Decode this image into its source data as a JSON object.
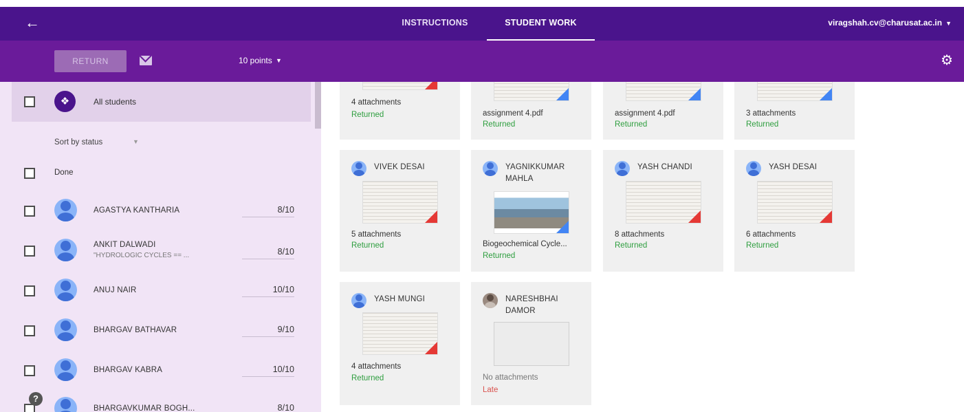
{
  "header": {
    "tabs": [
      {
        "label": "INSTRUCTIONS"
      },
      {
        "label": "STUDENT WORK"
      }
    ],
    "account": "viragshah.cv@charusat.ac.in"
  },
  "toolbar": {
    "return_label": "RETURN",
    "points_label": "10 points"
  },
  "sidebar": {
    "all_students_label": "All students",
    "sort_label": "Sort by status",
    "done_label": "Done",
    "students": [
      {
        "name": "AGASTYA KANTHARIA",
        "note": "",
        "grade": "8/10"
      },
      {
        "name": "ANKIT DALWADI",
        "note": "\"HYDROLOGIC CYCLES == ...",
        "grade": "8/10"
      },
      {
        "name": "ANUJ NAIR",
        "note": "",
        "grade": "10/10"
      },
      {
        "name": "BHARGAV BATHAVAR",
        "note": "",
        "grade": "9/10"
      },
      {
        "name": "BHARGAV KABRA",
        "note": "",
        "grade": "10/10"
      },
      {
        "name": "BHARGAVKUMAR BOGH...",
        "note": "",
        "grade": "8/10"
      }
    ]
  },
  "cards": [
    {
      "name": "",
      "attachment": "4 attachments",
      "status": "Returned"
    },
    {
      "name": "",
      "attachment": "assignment 4.pdf",
      "status": "Returned"
    },
    {
      "name": "",
      "attachment": "assignment 4.pdf",
      "status": "Returned"
    },
    {
      "name": "",
      "attachment": "3 attachments",
      "status": "Returned"
    },
    {
      "name": "VIVEK DESAI",
      "attachment": "5 attachments",
      "status": "Returned"
    },
    {
      "name": "YAGNIKKUMAR MAHLA",
      "attachment": "Biogeochemical Cycle...",
      "status": "Returned"
    },
    {
      "name": "YASH CHANDI",
      "attachment": "8 attachments",
      "status": "Returned"
    },
    {
      "name": "YASH DESAI",
      "attachment": "6 attachments",
      "status": "Returned"
    },
    {
      "name": "YASH MUNGI",
      "attachment": "4 attachments",
      "status": "Returned"
    },
    {
      "name": "NARESHBHAI DAMOR",
      "attachment": "No attachments",
      "status": "Late"
    }
  ],
  "colors": {
    "topbar": "#4a148c",
    "toolbar": "#6a1b9a",
    "sidebar": "#f1e4f6",
    "returned": "#2e9e3f",
    "late": "#d9534f"
  }
}
